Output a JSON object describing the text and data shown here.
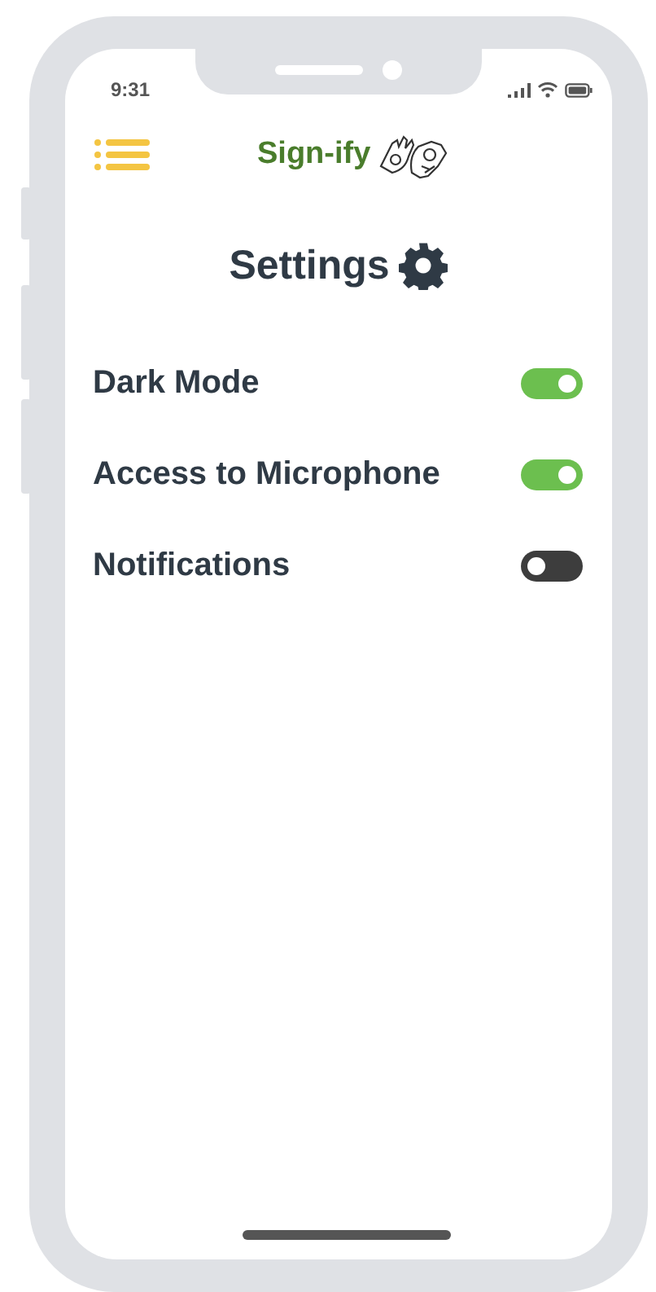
{
  "status_bar": {
    "time": "9:31"
  },
  "header": {
    "app_name": "Sign-ify"
  },
  "page": {
    "title": "Settings"
  },
  "settings": [
    {
      "label": "Dark Mode",
      "on": true
    },
    {
      "label": "Access to Microphone",
      "on": true
    },
    {
      "label": "Notifications",
      "on": false
    }
  ]
}
